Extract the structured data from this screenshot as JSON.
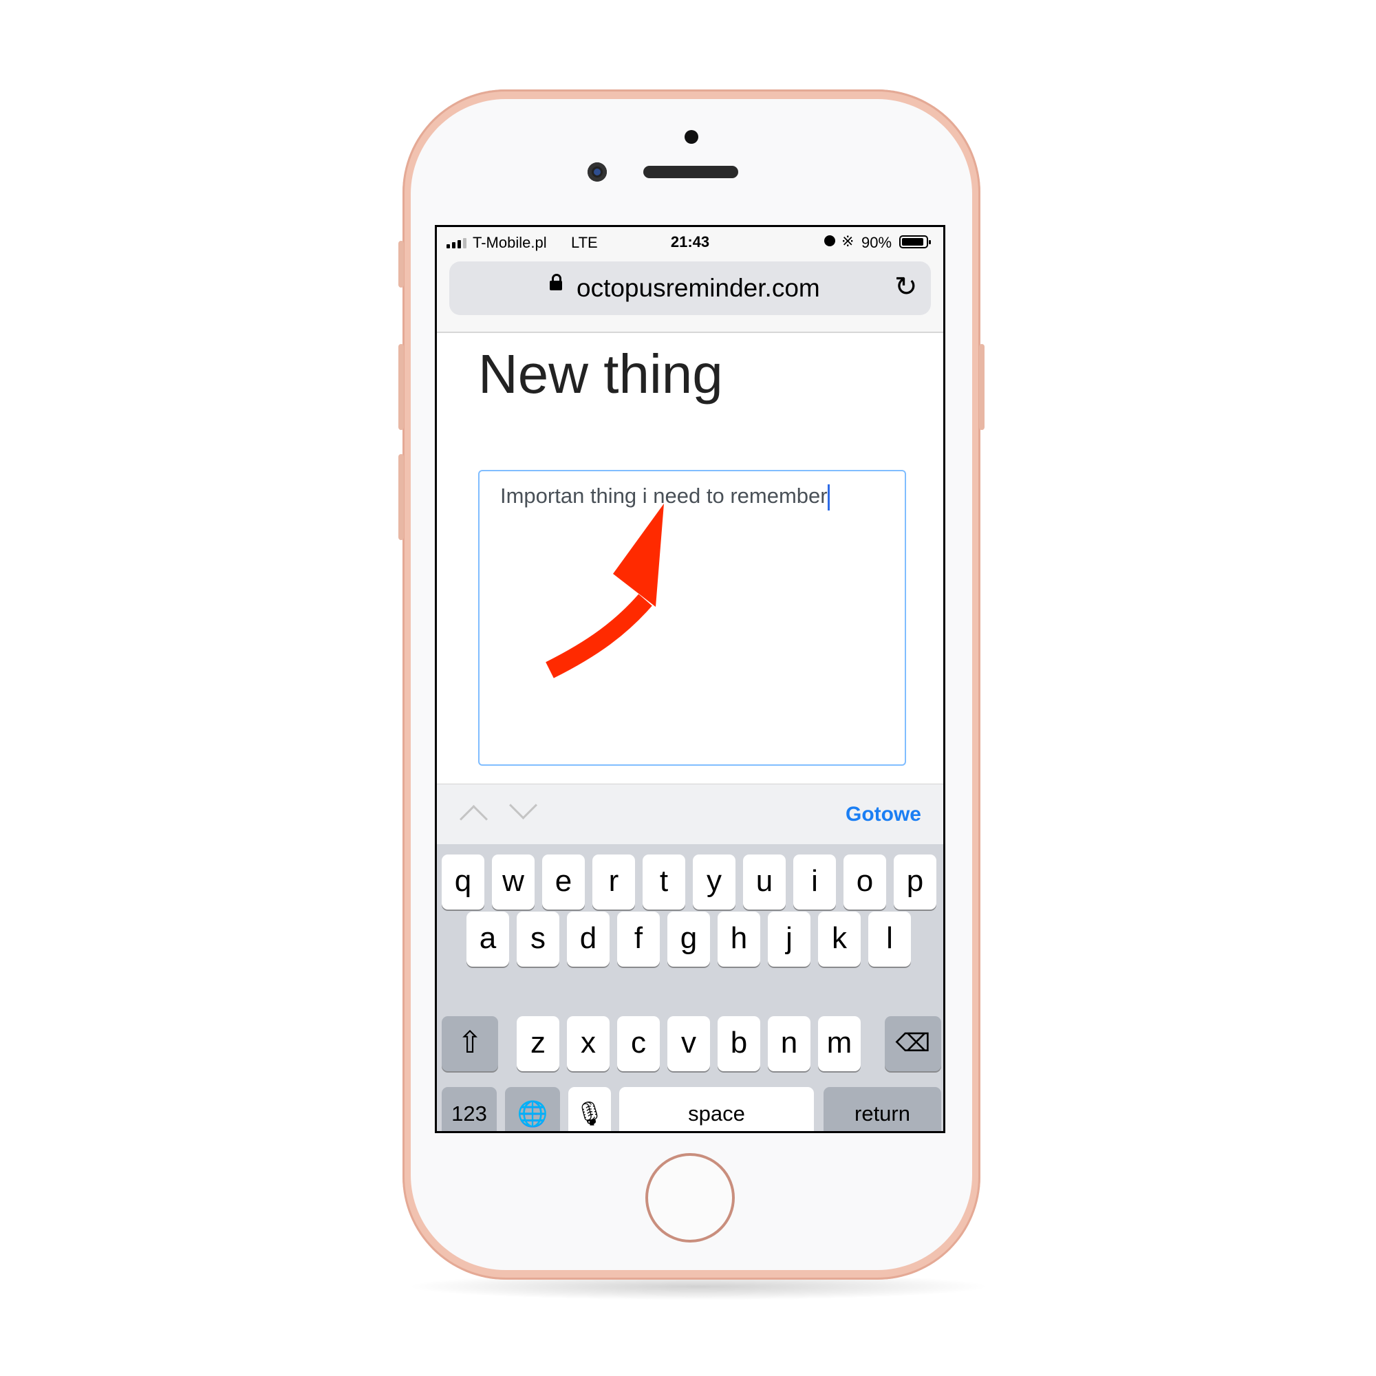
{
  "status_bar": {
    "carrier": "T-Mobile.pl",
    "network": "LTE",
    "time": "21:43",
    "battery_percent": "90%",
    "battery_level": 0.9,
    "signal_bars_on": 3,
    "icons": [
      "signal-icon",
      "alarm-icon",
      "bluetooth-icon",
      "battery-icon"
    ]
  },
  "browser": {
    "url": "octopusreminder.com",
    "lock_icon": "lock-icon",
    "reload_icon": "reload-icon"
  },
  "page": {
    "title": "New thing",
    "textarea_value": "Importan thing i need to remember",
    "annotation_color": "#ff2a00"
  },
  "accessory": {
    "prev_icon": "chevron-up-icon",
    "next_icon": "chevron-down-icon",
    "done_label": "Gotowe",
    "done_color": "#1a7ef3"
  },
  "keyboard": {
    "row1": [
      "q",
      "w",
      "e",
      "r",
      "t",
      "y",
      "u",
      "i",
      "o",
      "p"
    ],
    "row2": [
      "a",
      "s",
      "d",
      "f",
      "g",
      "h",
      "j",
      "k",
      "l"
    ],
    "row3": [
      "z",
      "x",
      "c",
      "v",
      "b",
      "n",
      "m"
    ],
    "shift_icon": "shift-icon",
    "backspace_icon": "backspace-icon",
    "numbers_label": "123",
    "globe_icon": "globe-icon",
    "mic_icon": "microphone-icon",
    "space_label": "space",
    "return_label": "return"
  }
}
